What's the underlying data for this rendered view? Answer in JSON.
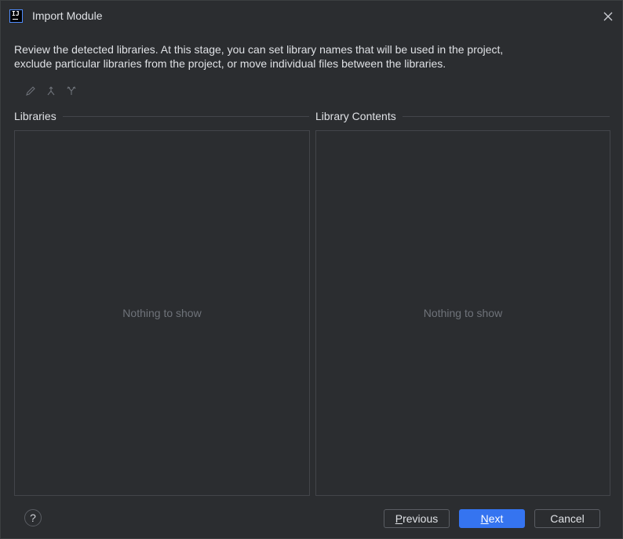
{
  "window": {
    "title": "Import Module",
    "app_icon_text": "IJ"
  },
  "description": {
    "line1": "Review the detected libraries. At this stage, you can set library names that will be used in the project,",
    "line2": "exclude particular libraries from the project, or move individual files between the libraries."
  },
  "toolbar": {
    "icons": [
      "edit-icon",
      "merge-icon",
      "split-icon"
    ]
  },
  "libraries": {
    "label": "Libraries",
    "empty_text": "Nothing to show"
  },
  "library_contents": {
    "label": "Library Contents",
    "empty_text": "Nothing to show"
  },
  "footer": {
    "help_label": "?",
    "previous_mnemonic": "P",
    "previous_rest": "revious",
    "next_mnemonic": "N",
    "next_rest": "ext",
    "cancel_label": "Cancel"
  },
  "colors": {
    "background": "#2b2d30",
    "primary_button": "#3574f0",
    "muted_text": "#6f737a"
  }
}
